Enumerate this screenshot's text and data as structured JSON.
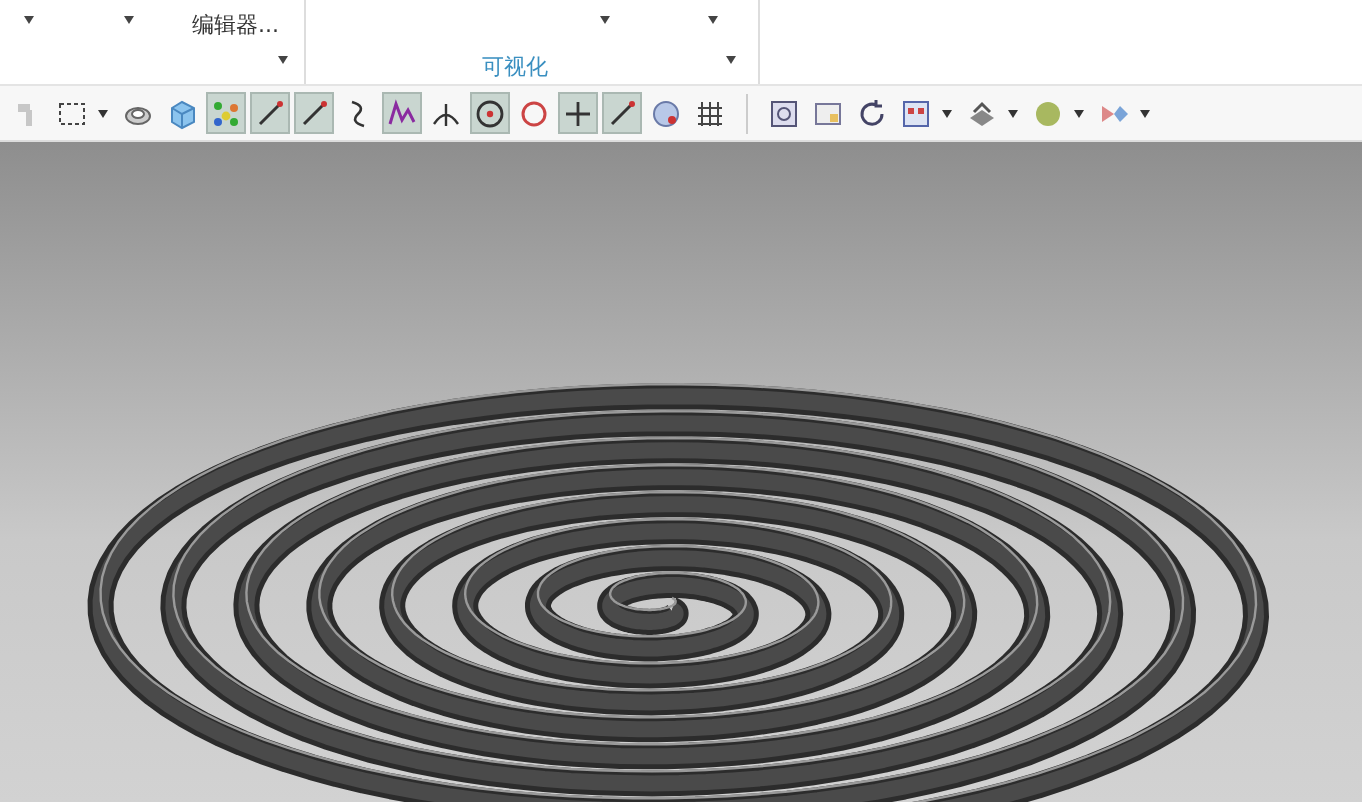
{
  "ribbon": {
    "editor_button": "编辑器...",
    "group_caption": "可视化"
  },
  "toolbar_groups": [
    [
      {
        "kind": "hand",
        "selected": false,
        "disabled": true,
        "dropdown": false
      },
      {
        "kind": "rect-select",
        "selected": false,
        "disabled": false,
        "dropdown": true
      },
      {
        "kind": "eraser",
        "selected": false,
        "disabled": false,
        "dropdown": false
      },
      {
        "kind": "cube",
        "selected": false,
        "disabled": false,
        "dropdown": false
      },
      {
        "kind": "points",
        "selected": true,
        "disabled": false,
        "dropdown": false
      },
      {
        "kind": "line",
        "selected": true,
        "disabled": false,
        "dropdown": false
      },
      {
        "kind": "line",
        "selected": true,
        "disabled": false,
        "dropdown": false
      },
      {
        "kind": "curve",
        "selected": false,
        "disabled": false,
        "dropdown": false
      },
      {
        "kind": "zigzag",
        "selected": true,
        "disabled": false,
        "dropdown": false
      },
      {
        "kind": "fork",
        "selected": false,
        "disabled": false,
        "dropdown": false
      },
      {
        "kind": "circle-dot",
        "selected": true,
        "disabled": false,
        "dropdown": false
      },
      {
        "kind": "circle",
        "selected": false,
        "disabled": false,
        "dropdown": false
      },
      {
        "kind": "plus",
        "selected": true,
        "disabled": false,
        "dropdown": false
      },
      {
        "kind": "line",
        "selected": true,
        "disabled": false,
        "dropdown": false
      },
      {
        "kind": "blob",
        "selected": false,
        "disabled": false,
        "dropdown": false
      },
      {
        "kind": "grid",
        "selected": false,
        "disabled": false,
        "dropdown": false
      }
    ],
    [
      {
        "kind": "frame",
        "selected": false,
        "disabled": false,
        "dropdown": false
      },
      {
        "kind": "window",
        "selected": false,
        "disabled": false,
        "dropdown": false
      },
      {
        "kind": "rotate",
        "selected": false,
        "disabled": false,
        "dropdown": false
      },
      {
        "kind": "layout",
        "selected": false,
        "disabled": false,
        "dropdown": true
      },
      {
        "kind": "layers",
        "selected": false,
        "disabled": false,
        "dropdown": true
      },
      {
        "kind": "sphere",
        "selected": false,
        "disabled": false,
        "dropdown": true
      },
      {
        "kind": "arrow",
        "selected": false,
        "disabled": false,
        "dropdown": true
      }
    ]
  ]
}
